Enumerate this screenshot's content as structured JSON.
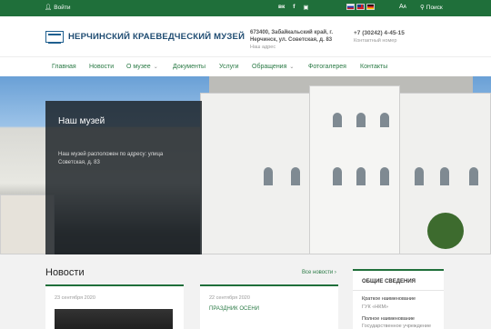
{
  "topbar": {
    "login_label": "Войти",
    "social_icons": [
      "vk-icon",
      "facebook-icon",
      "instagram-icon"
    ],
    "languages": [
      "ru",
      "en",
      "de"
    ],
    "font_size_label": "A",
    "font_size_label_small": "A",
    "search_label": "Поиск"
  },
  "header": {
    "title": "НЕРЧИНСКИЙ КРАЕВЕДЧЕСКИЙ МУЗЕЙ",
    "address_line1": "673400, Забайкальский край, г.",
    "address_line2": "Нерчинск, ул. Советская, д. 83",
    "address_caption": "Наш адрес",
    "phone": "+7 (30242) 4-45-15",
    "phone_caption": "Контактный номер"
  },
  "nav": {
    "items": [
      {
        "label": "Главная"
      },
      {
        "label": "Новости"
      },
      {
        "label": "О музее"
      },
      {
        "label": "Документы"
      },
      {
        "label": "Услуги"
      },
      {
        "label": "Обращения"
      },
      {
        "label": "Фотогалерея"
      },
      {
        "label": "Контакты"
      }
    ]
  },
  "hero": {
    "title": "Наш музей",
    "text": "Наш музей расположен по адресу: улица Советская, д. 83"
  },
  "news": {
    "section_title": "Новости",
    "all_link": "Все новости",
    "cards": [
      {
        "date": "23 сентября 2020",
        "headline": ""
      },
      {
        "date": "22 сентября 2020",
        "headline": "ПРАЗДНИК ОСЕНИ"
      }
    ]
  },
  "info": {
    "title": "ОБЩИЕ СВЕДЕНИЯ",
    "short_label": "Краткое наименование",
    "short_value": "ГУК «НКМ»",
    "full_label": "Полное наименование",
    "full_value": "Государственное учреждение"
  },
  "colors": {
    "brand_green": "#1f6f3a",
    "link_green": "#2a7a45",
    "title_blue": "#1f4c72"
  }
}
